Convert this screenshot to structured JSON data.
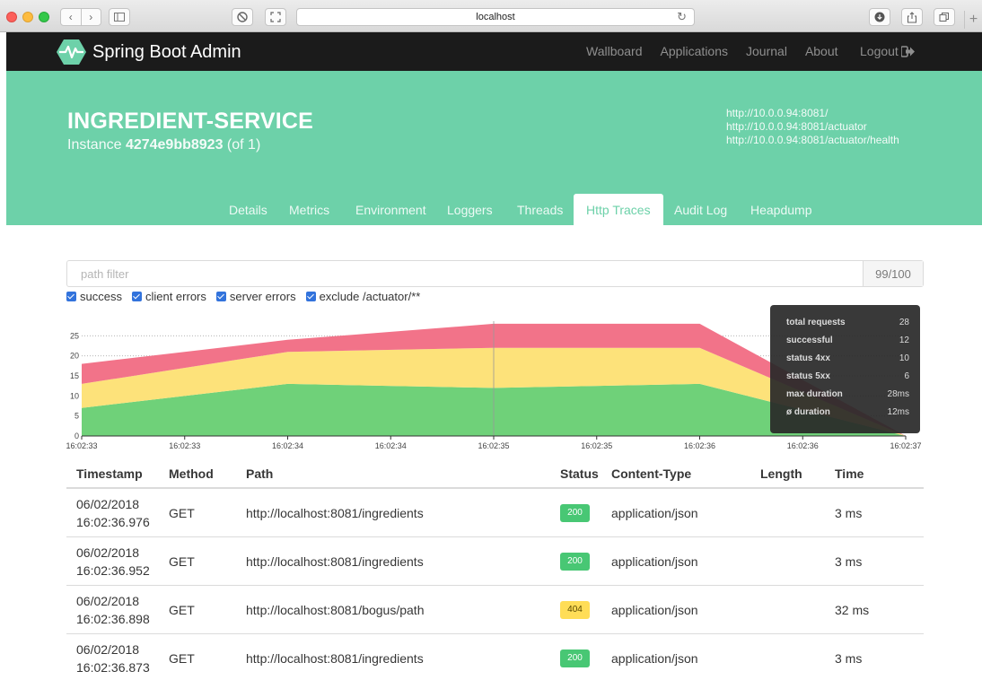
{
  "browser": {
    "url": "localhost"
  },
  "navbar": {
    "brand": "Spring Boot Admin",
    "links": [
      "Wallboard",
      "Applications",
      "Journal",
      "About"
    ],
    "logout": "Logout"
  },
  "instance": {
    "name": "INGREDIENT-SERVICE",
    "label_prefix": "Instance",
    "id": "4274e9bb8923",
    "count_label": "(of 1)",
    "urls": [
      "http://10.0.0.94:8081/",
      "http://10.0.0.94:8081/actuator",
      "http://10.0.0.94:8081/actuator/health"
    ]
  },
  "tabs": [
    "Details",
    "Metrics",
    "Environment",
    "Loggers",
    "Threads",
    "Http Traces",
    "Audit Log",
    "Heapdump"
  ],
  "active_tab": "Http Traces",
  "filter": {
    "placeholder": "path filter",
    "count": "99/100"
  },
  "checkboxes": [
    "success",
    "client errors",
    "server errors",
    "exclude /actuator/**"
  ],
  "chart_data": {
    "type": "area",
    "x": [
      "16:02:33",
      "16:02:33",
      "16:02:34",
      "16:02:34",
      "16:02:35",
      "16:02:35",
      "16:02:36",
      "16:02:36",
      "16:02:37"
    ],
    "y_ticks": [
      0,
      5,
      10,
      15,
      20,
      25
    ],
    "ylim": [
      0,
      30
    ],
    "series": [
      {
        "values": [
          7,
          13,
          12,
          13,
          0
        ],
        "color": "#6fd179"
      },
      {
        "values": [
          6,
          8,
          10,
          9,
          0
        ],
        "color": "#fde27a"
      },
      {
        "values": [
          5,
          3,
          6,
          6,
          0
        ],
        "color": "#f27389"
      }
    ],
    "tooltip": [
      {
        "label": "total requests",
        "value": "28"
      },
      {
        "label": "successful",
        "value": "12"
      },
      {
        "label": "status 4xx",
        "value": "10"
      },
      {
        "label": "status 5xx",
        "value": "6"
      },
      {
        "label": "max duration",
        "value": "28ms"
      },
      {
        "label": "ø duration",
        "value": "12ms"
      }
    ]
  },
  "table": {
    "headers": [
      "Timestamp",
      "Method",
      "Path",
      "Status",
      "Content-Type",
      "Length",
      "Time"
    ],
    "rows": [
      {
        "date": "06/02/2018",
        "time": "16:02:36.976",
        "method": "GET",
        "path": "http://localhost:8081/ingredients",
        "status": "200",
        "content_type": "application/json",
        "length": "",
        "duration": "3 ms"
      },
      {
        "date": "06/02/2018",
        "time": "16:02:36.952",
        "method": "GET",
        "path": "http://localhost:8081/ingredients",
        "status": "200",
        "content_type": "application/json",
        "length": "",
        "duration": "3 ms"
      },
      {
        "date": "06/02/2018",
        "time": "16:02:36.898",
        "method": "GET",
        "path": "http://localhost:8081/bogus/path",
        "status": "404",
        "content_type": "application/json",
        "length": "",
        "duration": "32 ms"
      },
      {
        "date": "06/02/2018",
        "time": "16:02:36.873",
        "method": "GET",
        "path": "http://localhost:8081/ingredients",
        "status": "200",
        "content_type": "application/json",
        "length": "",
        "duration": "3 ms"
      }
    ]
  }
}
